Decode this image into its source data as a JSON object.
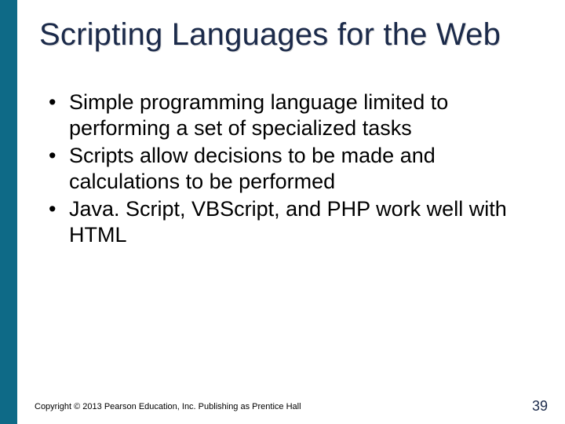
{
  "slide": {
    "title": "Scripting Languages for the Web",
    "bullets": [
      "Simple programming language limited to performing a set of specialized tasks",
      "Scripts allow decisions to be made and calculations to be performed",
      "Java. Script, VBScript, and PHP work well with HTML"
    ],
    "copyright": "Copyright © 2013 Pearson Education, Inc. Publishing as Prentice Hall",
    "page_number": "39"
  }
}
